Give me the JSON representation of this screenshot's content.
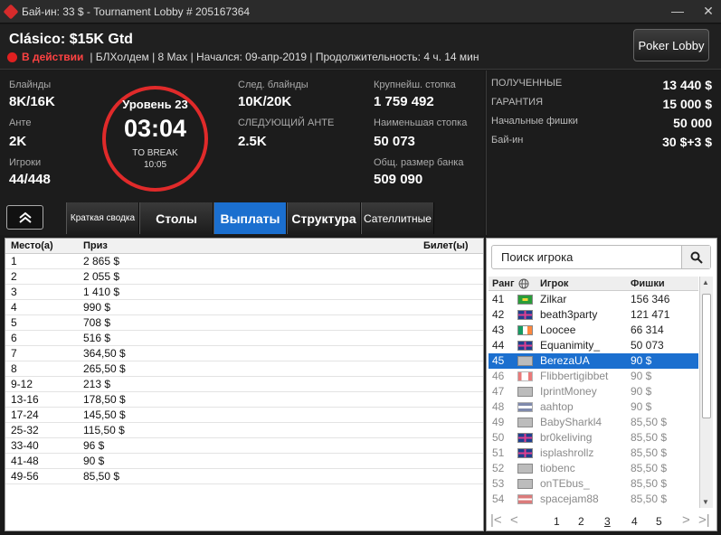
{
  "window": {
    "title": "Бай-ин: 33 $ - Tournament Lobby # 205167364",
    "minimize": "—",
    "close": "✕"
  },
  "header": {
    "tournament_name": "Clásico: $15K Gtd",
    "status": "В действии",
    "details": "| БЛХолдем | 8 Max | Начался: 09-апр-2019 | Продолжительность: 4 ч. 14 мин",
    "lobby_button": "Poker Lobby"
  },
  "stats": {
    "blinds_label": "Блайнды",
    "blinds": "8K/16K",
    "ante_label": "Анте",
    "ante": "2K",
    "players_label": "Игроки",
    "players": "44/448",
    "level": "Уровень 23",
    "clock": "03:04",
    "to_break_label": "TO BREAK",
    "break_time": "10:05",
    "next_blinds_label": "След. блайнды",
    "next_blinds": "10K/20K",
    "next_ante_label": "СЛЕДУЮЩИЙ АНТЕ",
    "next_ante": "2.5K",
    "largest_stack_label": "Крупнейш. стопка",
    "largest_stack": "1 759 492",
    "smallest_stack_label": "Наименьшая стопка",
    "smallest_stack": "50 073",
    "total_pot_label": "Общ. размер банка",
    "total_pot": "509 090"
  },
  "summary": {
    "received_label": "ПОЛУЧЕННЫЕ",
    "received": "13 440 $",
    "guarantee_label": "ГАРАНТИЯ",
    "guarantee": "15 000 $",
    "start_chips_label": "Начальные фишки",
    "start_chips": "50 000",
    "buyin_label": "Бай-ин",
    "buyin": "30 $+3 $"
  },
  "collapse_icon": "chevrons-up-icon",
  "tabs": [
    "Краткая сводка",
    "Столы",
    "Выплаты",
    "Структура",
    "Сателлитные"
  ],
  "active_tab": "Выплаты",
  "payouts": {
    "headers": [
      "Место(а)",
      "Приз",
      "Билет(ы)"
    ],
    "rows": [
      [
        "1",
        "2 865 $"
      ],
      [
        "2",
        "2 055 $"
      ],
      [
        "3",
        "1 410 $"
      ],
      [
        "4",
        "990 $"
      ],
      [
        "5",
        "708 $"
      ],
      [
        "6",
        "516 $"
      ],
      [
        "7",
        "364,50 $"
      ],
      [
        "8",
        "265,50 $"
      ],
      [
        "9-12",
        "213 $"
      ],
      [
        "13-16",
        "178,50 $"
      ],
      [
        "17-24",
        "145,50 $"
      ],
      [
        "25-32",
        "115,50 $"
      ],
      [
        "33-40",
        "96 $"
      ],
      [
        "41-48",
        "90 $"
      ],
      [
        "49-56",
        "85,50 $"
      ]
    ]
  },
  "players": {
    "search_placeholder": "Поиск игрока",
    "headers": [
      "Ранг",
      "Игрок",
      "Фишки"
    ],
    "rows": [
      {
        "rank": "41",
        "flag": "brazil",
        "name": "Zilkar",
        "chips": "156 346",
        "state": "normal"
      },
      {
        "rank": "42",
        "flag": "uk",
        "name": "beath3party",
        "chips": "121 471",
        "state": "normal"
      },
      {
        "rank": "43",
        "flag": "ireland",
        "name": "Loocee",
        "chips": "66 314",
        "state": "normal"
      },
      {
        "rank": "44",
        "flag": "uk",
        "name": "Equanimity_",
        "chips": "50 073",
        "state": "normal"
      },
      {
        "rank": "45",
        "flag": "grey",
        "name": "BerezaUA",
        "chips": "90 $",
        "state": "selected"
      },
      {
        "rank": "46",
        "flag": "canada",
        "name": "Flibbertigibbet",
        "chips": "90 $",
        "state": "dim"
      },
      {
        "rank": "47",
        "flag": "grey",
        "name": "IprintMoney",
        "chips": "90 $",
        "state": "dim"
      },
      {
        "rank": "48",
        "flag": "striped",
        "name": "aahtop",
        "chips": "90 $",
        "state": "dim"
      },
      {
        "rank": "49",
        "flag": "grey",
        "name": "BabySharkl4",
        "chips": "85,50 $",
        "state": "dim"
      },
      {
        "rank": "50",
        "flag": "uk",
        "name": "br0keliving",
        "chips": "85,50 $",
        "state": "dim"
      },
      {
        "rank": "51",
        "flag": "uk",
        "name": "isplashrollz",
        "chips": "85,50 $",
        "state": "dim"
      },
      {
        "rank": "52",
        "flag": "grey",
        "name": "tiobenc",
        "chips": "85,50 $",
        "state": "dim"
      },
      {
        "rank": "53",
        "flag": "grey",
        "name": "onTEbus_",
        "chips": "85,50 $",
        "state": "dim"
      },
      {
        "rank": "54",
        "flag": "cross",
        "name": "spacejam88",
        "chips": "85,50 $",
        "state": "dim"
      }
    ],
    "pager": [
      "1",
      "2",
      "3",
      "4",
      "5"
    ],
    "current_page": "3"
  },
  "colors": {
    "accent": "#1b6fcf",
    "status_red": "#e02020",
    "clock_ring": "#e02a2a"
  }
}
